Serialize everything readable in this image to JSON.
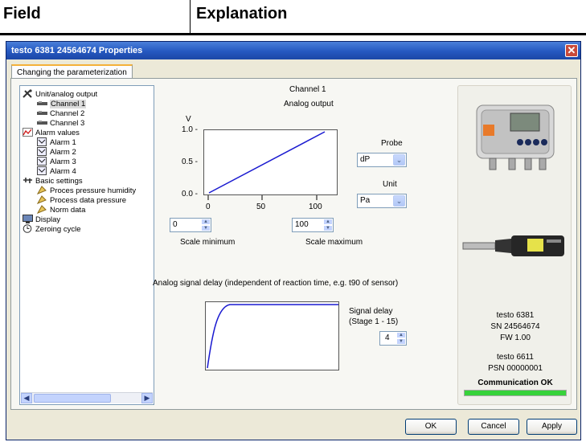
{
  "doc_table": {
    "col1": "Field",
    "col2": "Explanation"
  },
  "window": {
    "title": "testo 6381  24564674 Properties",
    "close": "✕"
  },
  "tabs": [
    {
      "label": "Changing the parameterization"
    }
  ],
  "tree": {
    "items": [
      {
        "label": "Unit/analog output",
        "icon": "wrench-icon"
      },
      {
        "label": "Channel 1",
        "icon": "channel-icon",
        "selected": true
      },
      {
        "label": "Channel 2",
        "icon": "channel-icon"
      },
      {
        "label": "Channel 3",
        "icon": "channel-icon"
      },
      {
        "label": "Alarm values",
        "icon": "alarm-chart-icon"
      },
      {
        "label": "Alarm 1",
        "icon": "alarm-icon"
      },
      {
        "label": "Alarm 2",
        "icon": "alarm-icon"
      },
      {
        "label": "Alarm 3",
        "icon": "alarm-icon"
      },
      {
        "label": "Alarm 4",
        "icon": "alarm-icon"
      },
      {
        "label": "Basic settings",
        "icon": "settings-icon"
      },
      {
        "label": "Proces pressure humidity",
        "icon": "process-icon"
      },
      {
        "label": "Process data pressure",
        "icon": "process-icon"
      },
      {
        "label": "Norm data",
        "icon": "process-icon"
      },
      {
        "label": "Display",
        "icon": "display-icon"
      },
      {
        "label": "Zeroing cycle",
        "icon": "clock-icon"
      }
    ]
  },
  "analog": {
    "channel_title": "Channel 1",
    "subtitle": "Analog output",
    "y_unit": "V",
    "y_ticks": [
      "1.0 -",
      "0.5 -",
      "0.0 -"
    ],
    "x_ticks": [
      "0",
      "50",
      "100"
    ],
    "scale_min_value": "0",
    "scale_max_value": "100",
    "scale_min_label": "Scale minimum",
    "scale_max_label": "Scale maximum"
  },
  "probe": {
    "label": "Probe",
    "value": "dP"
  },
  "unit": {
    "label": "Unit",
    "value": "Pa"
  },
  "delay": {
    "description": "Analog signal delay (independent of reaction time, e.g. t90 of sensor)",
    "label_line1": "Signal delay",
    "label_line2": "(Stage 1 - 15)",
    "value": "4"
  },
  "device_info": {
    "model": "testo 6381",
    "sn": "SN 24564674",
    "fw": "FW  1.00",
    "probe_model": "testo 6611",
    "psn": "PSN 00000001",
    "status": "Communication OK",
    "status_color": "#37d23a",
    "progress": 1.0
  },
  "buttons": {
    "ok": "OK",
    "cancel": "Cancel",
    "apply": "Apply"
  },
  "chart_data": {
    "type": "line",
    "series": [
      {
        "x": [
          0,
          100
        ],
        "y": [
          0.0,
          1.0
        ]
      }
    ],
    "xlim": [
      0,
      100
    ],
    "ylim": [
      0.0,
      1.0
    ],
    "ylabel": "V",
    "line_color": "#1a1ad0"
  }
}
